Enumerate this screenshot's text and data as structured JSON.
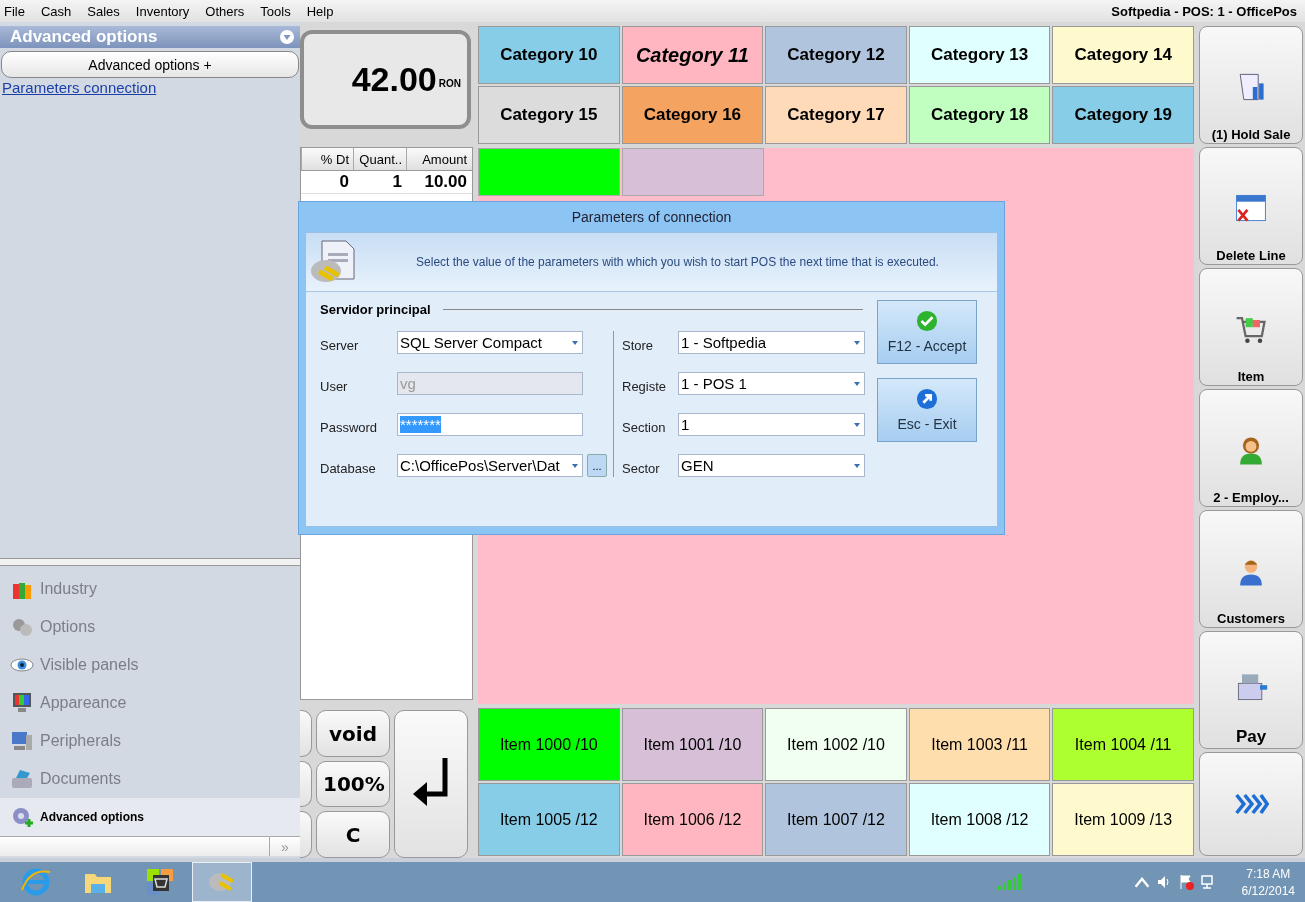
{
  "menu": [
    {
      "label": "File"
    },
    {
      "label": "Cash"
    },
    {
      "label": "Sales"
    },
    {
      "label": "Inventory"
    },
    {
      "label": "Others"
    },
    {
      "label": "Tools"
    },
    {
      "label": "Help"
    }
  ],
  "window": {
    "title": "Softpedia - POS: 1 - OfficePos"
  },
  "side_panel": {
    "title": "Advanced options",
    "button": "Advanced options +",
    "link": "Parameters connection",
    "nav": [
      {
        "label": "Industry",
        "kind": "industry",
        "selected": false
      },
      {
        "label": "Options",
        "kind": "options",
        "selected": false
      },
      {
        "label": "Visible panels",
        "kind": "panels",
        "selected": false
      },
      {
        "label": "Appareance",
        "kind": "appearance",
        "selected": false
      },
      {
        "label": "Peripherals",
        "kind": "peripherals",
        "selected": false
      },
      {
        "label": "Documents",
        "kind": "documents",
        "selected": false
      },
      {
        "label": "Advanced options",
        "kind": "advanced",
        "selected": true
      }
    ],
    "more": "»"
  },
  "total": {
    "amount": "42.00",
    "currency": "RON"
  },
  "ticket": {
    "columns": [
      "% Dt",
      "Quant..",
      "Amount"
    ],
    "rows": [
      [
        "0",
        "1",
        "10.00"
      ]
    ]
  },
  "keypad": [
    {
      "label": "void"
    },
    {
      "label": "100%"
    },
    {
      "label": "C"
    }
  ],
  "categories": [
    {
      "label": "Category 10",
      "color": "#87cde8",
      "selected": false
    },
    {
      "label": "Category 11",
      "color": "#ffb6c1",
      "selected": true
    },
    {
      "label": "Category 12",
      "color": "#b0c4de",
      "selected": false
    },
    {
      "label": "Category 13",
      "color": "#e0ffff",
      "selected": false
    },
    {
      "label": "Category 14",
      "color": "#fffacd",
      "selected": false
    },
    {
      "label": "Category 15",
      "color": "#dcdcdc",
      "selected": false
    },
    {
      "label": "Category 16",
      "color": "#f4a460",
      "selected": false
    },
    {
      "label": "Category 17",
      "color": "#ffdab9",
      "selected": false
    },
    {
      "label": "Category 18",
      "color": "#c1ffc1",
      "selected": false
    },
    {
      "label": "Category 19",
      "color": "#87cde8",
      "selected": false
    }
  ],
  "subcategories": [
    {
      "color": "#00ff00"
    },
    {
      "color": "#d8bfd8"
    }
  ],
  "items": [
    {
      "label": "Item 1000 /10",
      "color": "#00ff00"
    },
    {
      "label": "Item 1001 /10",
      "color": "#d8bfd8"
    },
    {
      "label": "Item 1002 /10",
      "color": "#f0fff0"
    },
    {
      "label": "Item 1003 /11",
      "color": "#ffdead"
    },
    {
      "label": "Item 1004 /11",
      "color": "#adff2f"
    },
    {
      "label": "Item 1005 /12",
      "color": "#87cde8"
    },
    {
      "label": "Item 1006 /12",
      "color": "#ffb6c1"
    },
    {
      "label": "Item 1007 /12",
      "color": "#b0c4de"
    },
    {
      "label": "Item 1008 /12",
      "color": "#e0ffff"
    },
    {
      "label": "Item 1009 /13",
      "color": "#fffacd"
    }
  ],
  "actions": [
    {
      "label": "(1) Hold Sale",
      "kind": "hold"
    },
    {
      "label": "Delete Line",
      "kind": "delete"
    },
    {
      "label": "Item",
      "kind": "item"
    },
    {
      "label": "2 - Employ...",
      "kind": "employee"
    },
    {
      "label": "Customers",
      "kind": "customer"
    },
    {
      "label": "Pay",
      "kind": "pay"
    },
    {
      "kind": "next"
    }
  ],
  "dialog": {
    "title": "Parameters of connection",
    "message": "Select the value of the parameters with which you wish to start POS the next time that is executed.",
    "section": "Servidor principal",
    "left_fields": [
      {
        "label": "Server",
        "value": "SQL Server Compact",
        "kind": "combo",
        "disabled": false
      },
      {
        "label": "User",
        "value": "vg",
        "kind": "text",
        "disabled": true
      },
      {
        "label": "Password",
        "value": "*******",
        "kind": "text",
        "disabled": false,
        "highlighted": true
      },
      {
        "label": "Database",
        "value": "C:\\OfficePos\\Server\\Dat",
        "kind": "combo",
        "disabled": false,
        "browse": "..."
      }
    ],
    "right_fields": [
      {
        "label": "Store",
        "value": "1 - Softpedia",
        "kind": "combo"
      },
      {
        "label": "Registe",
        "value": "1 - POS 1",
        "kind": "combo"
      },
      {
        "label": "Section",
        "value": "1",
        "kind": "combo"
      },
      {
        "label": "Sector",
        "value": "GEN",
        "kind": "combo"
      }
    ],
    "buttons": [
      {
        "label": "F12 - Accept",
        "kind": "accept"
      },
      {
        "label": "Esc - Exit",
        "kind": "exit"
      }
    ]
  },
  "taskbar": {
    "apps": [
      {
        "kind": "browser",
        "selected": false
      },
      {
        "kind": "folder",
        "selected": false
      },
      {
        "kind": "pos",
        "selected": false
      },
      {
        "kind": "plug",
        "selected": true
      }
    ],
    "time": "7:18 AM",
    "date": "6/12/2014"
  }
}
